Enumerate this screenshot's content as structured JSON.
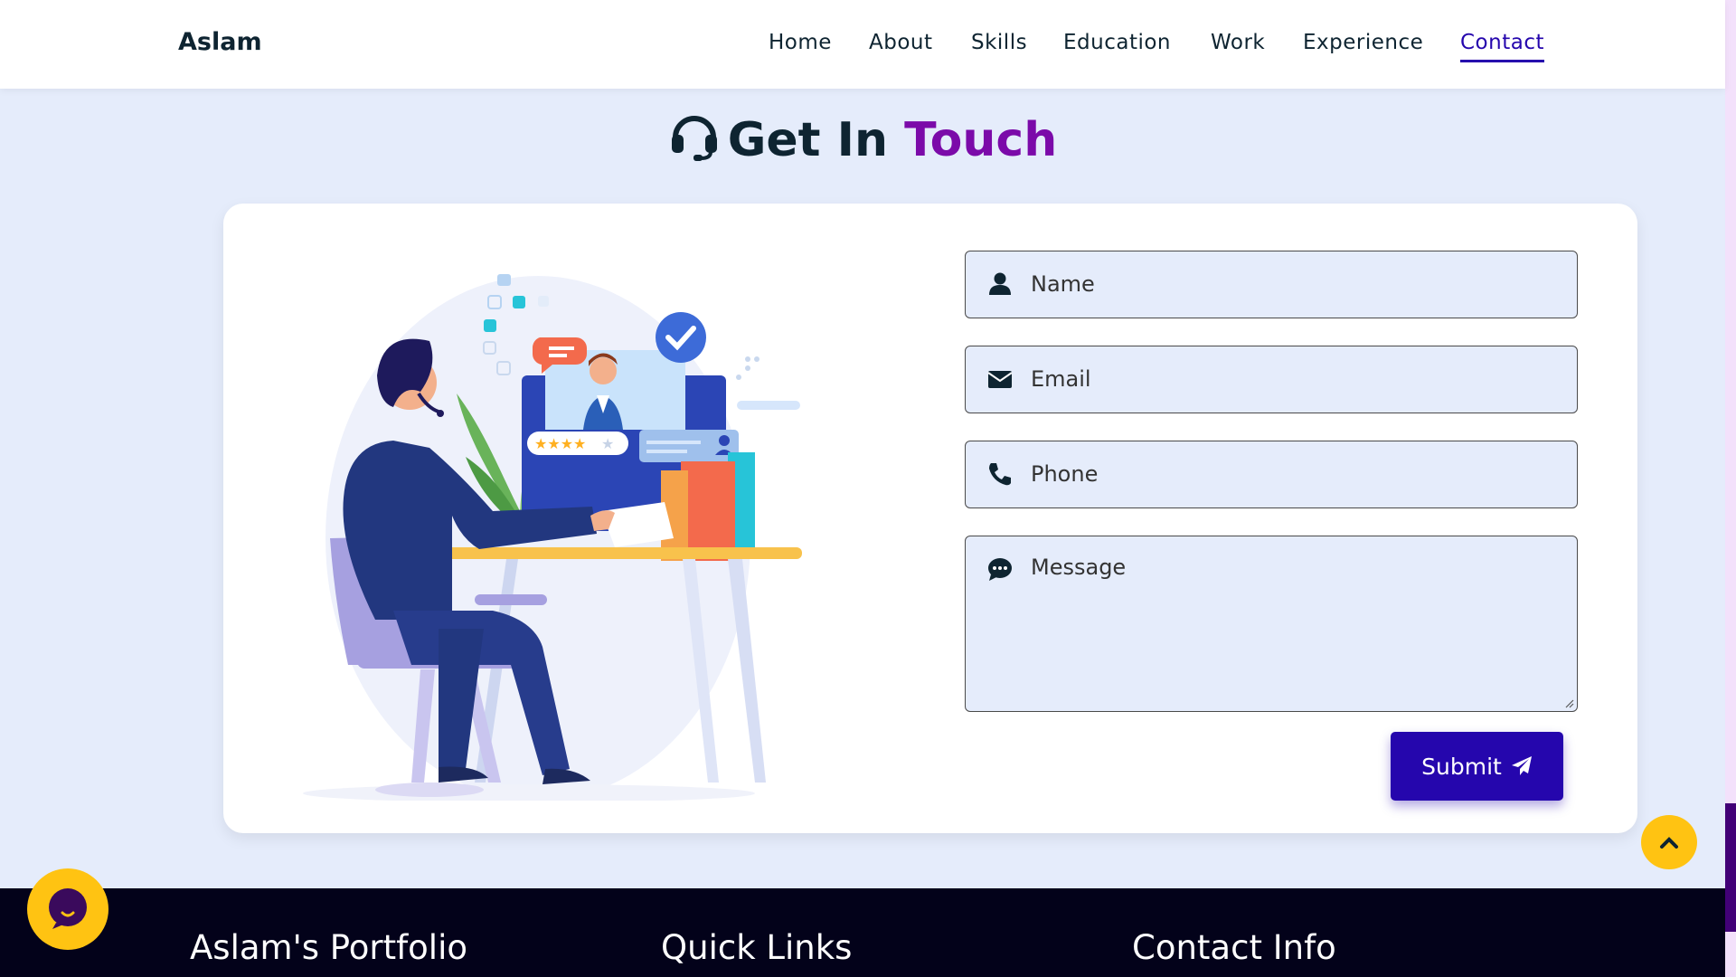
{
  "header": {
    "logo": "Aslam",
    "nav": [
      {
        "label": "Home"
      },
      {
        "label": "About"
      },
      {
        "label": "Skills"
      },
      {
        "label": "Education"
      },
      {
        "label": "Work"
      },
      {
        "label": "Experience"
      },
      {
        "label": "Contact",
        "active": true
      }
    ]
  },
  "section": {
    "icon": "headset-icon",
    "title_main": "Get In",
    "title_accent": "Touch"
  },
  "form": {
    "name_placeholder": "Name",
    "email_placeholder": "Email",
    "phone_placeholder": "Phone",
    "message_placeholder": "Message",
    "submit_label": "Submit",
    "submit_icon": "paper-plane-icon"
  },
  "footer": {
    "col1_title": "Aslam's Portfolio",
    "col2_title": "Quick Links",
    "col3_title": "Contact Info"
  },
  "colors": {
    "accent": "#2506ad",
    "title_accent": "#7b0aa9",
    "yellow": "#ffc312",
    "page_bg": "#e5ecfb",
    "footer_bg": "#03021a"
  }
}
